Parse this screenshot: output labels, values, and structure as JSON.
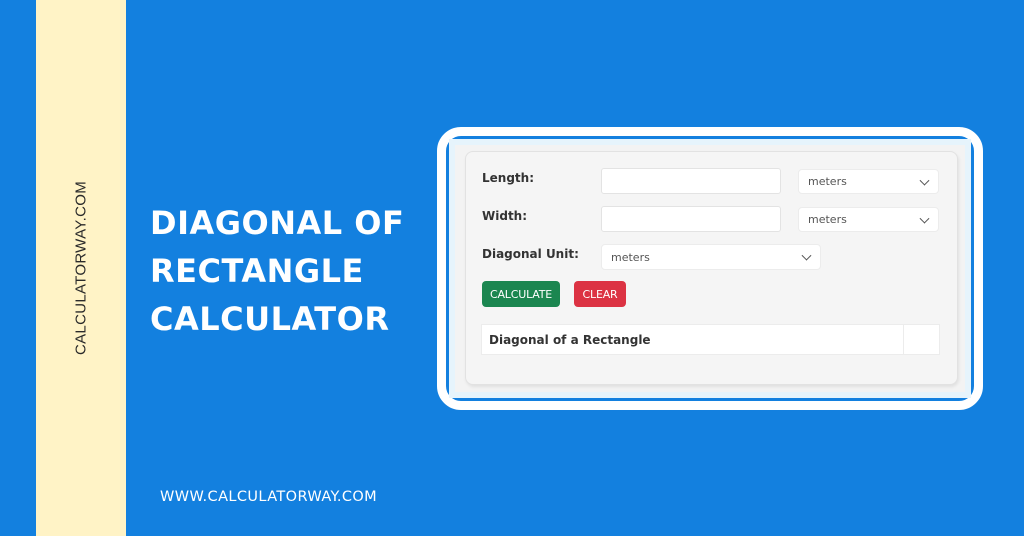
{
  "brand": {
    "vertical_text": "CALCULATORWAY.COM",
    "footer_url": "WWW.CALCULATORWAY.COM"
  },
  "headline": {
    "lines": [
      "DIAGONAL OF",
      "RECTANGLE",
      "CALCULATOR"
    ]
  },
  "calculator": {
    "length": {
      "label": "Length:",
      "value": "",
      "unit": "meters"
    },
    "width": {
      "label": "Width:",
      "value": "",
      "unit": "meters"
    },
    "diagonal_unit": {
      "label": "Diagonal Unit:",
      "unit": "meters"
    },
    "buttons": {
      "calculate": "CALCULATE",
      "clear": "CLEAR"
    },
    "result": {
      "label": "Diagonal of a Rectangle",
      "value": ""
    }
  },
  "colors": {
    "background": "#1380df",
    "side_strip": "#fff3c6",
    "calculate_button": "#1b8650",
    "clear_button": "#dc3343"
  }
}
